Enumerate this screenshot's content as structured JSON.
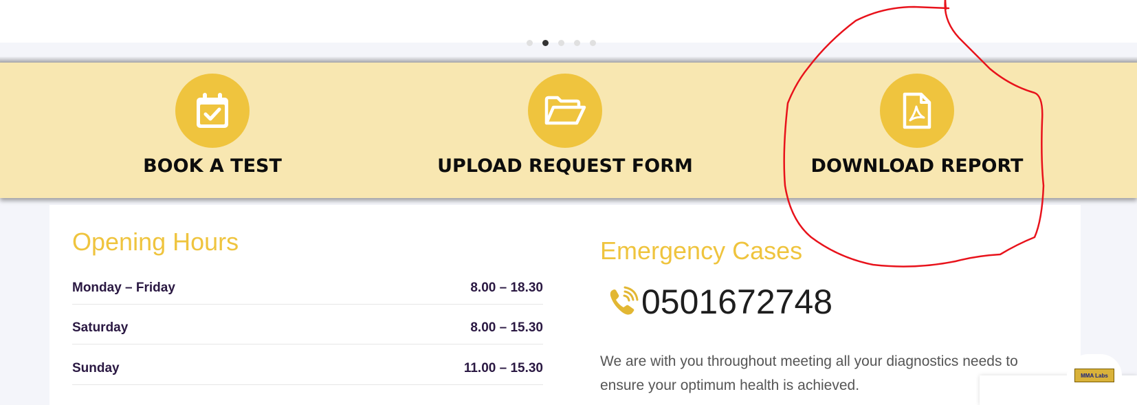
{
  "carousel": {
    "dot_count": 5,
    "active_index": 1
  },
  "quick_actions": [
    {
      "label": "BOOK A TEST",
      "icon": "calendar-check-icon"
    },
    {
      "label": "UPLOAD REQUEST FORM",
      "icon": "folder-open-icon"
    },
    {
      "label": "DOWNLOAD REPORT",
      "icon": "pdf-file-icon"
    }
  ],
  "opening_hours": {
    "title": "Opening Hours",
    "rows": [
      {
        "day": "Monday – Friday",
        "time": "8.00 – 18.30"
      },
      {
        "day": "Saturday",
        "time": "8.00 – 15.30"
      },
      {
        "day": "Sunday",
        "time": "11.00 – 15.30"
      }
    ]
  },
  "emergency": {
    "title": "Emergency Cases",
    "phone": "0501672748",
    "phone_icon": "phone-ringing-icon",
    "description": "We are with you throughout meeting all your diagnostics needs  to ensure your optimum health is achieved."
  },
  "chat_logo": {
    "text": "MMA Labs"
  },
  "colors": {
    "accent": "#efc43e",
    "band_bg": "#f8e7b1",
    "annotation": "#e8121b"
  }
}
